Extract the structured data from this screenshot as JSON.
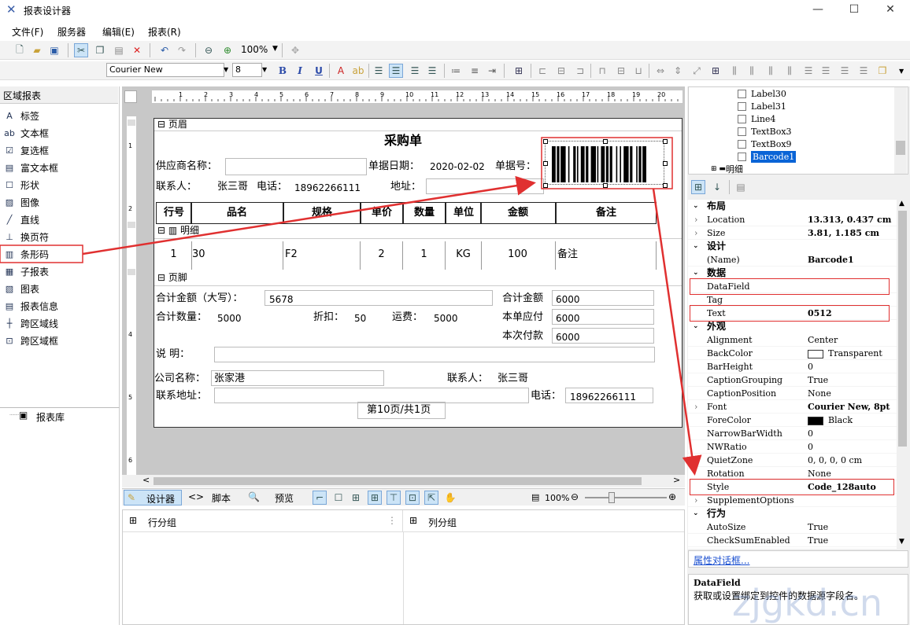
{
  "window": {
    "title": "报表设计器",
    "min": "—",
    "max": "☐",
    "close": "✕"
  },
  "menu": [
    "文件(F)",
    "服务器",
    "编辑(E)",
    "报表(R)"
  ],
  "toolbar": {
    "zoom": "100%",
    "font": "Courier New",
    "size": "8"
  },
  "left_panel": {
    "title": "区域报表",
    "items": [
      {
        "label": "标签",
        "icon": "label-icon"
      },
      {
        "label": "文本框",
        "icon": "textbox-icon"
      },
      {
        "label": "复选框",
        "icon": "checkbox-icon"
      },
      {
        "label": "富文本框",
        "icon": "richtext-icon"
      },
      {
        "label": "形状",
        "icon": "shape-icon"
      },
      {
        "label": "图像",
        "icon": "image-icon"
      },
      {
        "label": "直线",
        "icon": "line-icon"
      },
      {
        "label": "换页符",
        "icon": "pagebreak-icon"
      },
      {
        "label": "条形码",
        "icon": "barcode-icon"
      },
      {
        "label": "子报表",
        "icon": "subreport-icon"
      },
      {
        "label": "图表",
        "icon": "chart-icon"
      },
      {
        "label": "报表信息",
        "icon": "reportinfo-icon"
      },
      {
        "label": "跨区域线",
        "icon": "crossline-icon"
      },
      {
        "label": "跨区域框",
        "icon": "crossbox-icon"
      }
    ],
    "library": "报表库"
  },
  "report": {
    "header_band": "页眉",
    "title": "采购单",
    "supplier_label": "供应商名称：",
    "doc_date_label": "单据日期：",
    "doc_date": "2020-02-02",
    "doc_no_label": "单据号：",
    "contact_label": "联系人：",
    "contact": "张三哥",
    "phone_label": "电话：",
    "phone": "18962266111",
    "address_label": "地址：",
    "columns": [
      "行号",
      "品名",
      "规格",
      "单价",
      "数量",
      "单位",
      "金额",
      "备注"
    ],
    "detail_band": "明细",
    "row": [
      "1",
      "30",
      "F2",
      "2",
      "1",
      "KG",
      "100",
      "备注"
    ],
    "footer_band": "页脚",
    "total_upper_label": "合计金额（大写）：",
    "total_upper": "5678",
    "total_amount_label": "合计金额",
    "total_amount": "6000",
    "total_qty_label": "合计数量：",
    "total_qty": "5000",
    "discount_label": "折扣：",
    "discount": "50",
    "freight_label": "运费：",
    "freight": "5000",
    "payable_label": "本单应付",
    "payable": "6000",
    "paid_label": "本次付款",
    "paid": "6000",
    "note_label": "说 明：",
    "company_label": "公司名称：",
    "company": "张家港",
    "contact2_label": "联系人：",
    "contact2": "张三哥",
    "company_addr_label": "联系地址：",
    "phone2_label": "电话：",
    "phone2": "18962266111",
    "page": "第10页/共1页"
  },
  "ruler_left": [
    "1",
    "2",
    "3",
    "4",
    "5",
    "6"
  ],
  "tabs": {
    "designer": "设计器",
    "script": "脚本",
    "preview": "预览",
    "zoom": "100%"
  },
  "groups": {
    "row": "行分组",
    "col": "列分组"
  },
  "tree": [
    "Label30",
    "Label31",
    "Line4",
    "TextBox3",
    "TextBox9",
    "Barcode1",
    "明细"
  ],
  "props": [
    {
      "cat": "布局"
    },
    {
      "k": "Location",
      "v": "13.313, 0.437 cm",
      "bold": true,
      "exp": true
    },
    {
      "k": "Size",
      "v": "3.81, 1.185 cm",
      "bold": true,
      "exp": true
    },
    {
      "cat": "设计"
    },
    {
      "k": "(Name)",
      "v": "Barcode1",
      "bold": true
    },
    {
      "cat": "数据"
    },
    {
      "k": "DataField",
      "v": ""
    },
    {
      "k": "Tag",
      "v": ""
    },
    {
      "k": "Text",
      "v": "0512",
      "bold": true
    },
    {
      "cat": "外观"
    },
    {
      "k": "Alignment",
      "v": "Center"
    },
    {
      "k": "BackColor",
      "v": "Transparent",
      "swatch": "#ffffff"
    },
    {
      "k": "BarHeight",
      "v": "0"
    },
    {
      "k": "CaptionGrouping",
      "v": "True"
    },
    {
      "k": "CaptionPosition",
      "v": "None"
    },
    {
      "k": "Font",
      "v": "Courier New, 8pt",
      "bold": true,
      "exp": true
    },
    {
      "k": "ForeColor",
      "v": "Black",
      "swatch": "#000000"
    },
    {
      "k": "NarrowBarWidth",
      "v": "0"
    },
    {
      "k": "NWRatio",
      "v": "0"
    },
    {
      "k": "QuietZone",
      "v": "0, 0, 0, 0 cm",
      "exp": true
    },
    {
      "k": "Rotation",
      "v": "None"
    },
    {
      "k": "Style",
      "v": "Code_128auto",
      "bold": true
    },
    {
      "k": "SupplementOptions",
      "v": "",
      "exp": true
    },
    {
      "cat": "行为"
    },
    {
      "k": "AutoSize",
      "v": "True"
    },
    {
      "k": "CheckSumEnabled",
      "v": "True"
    }
  ],
  "dialog_link": "属性对话框...",
  "description": {
    "title": "DataField",
    "text": "获取或设置绑定到控件的数据源字段名。"
  },
  "watermark": "zjgkd.cn",
  "colors": {
    "accent": "#e03030",
    "selection": "#cce4f7"
  }
}
